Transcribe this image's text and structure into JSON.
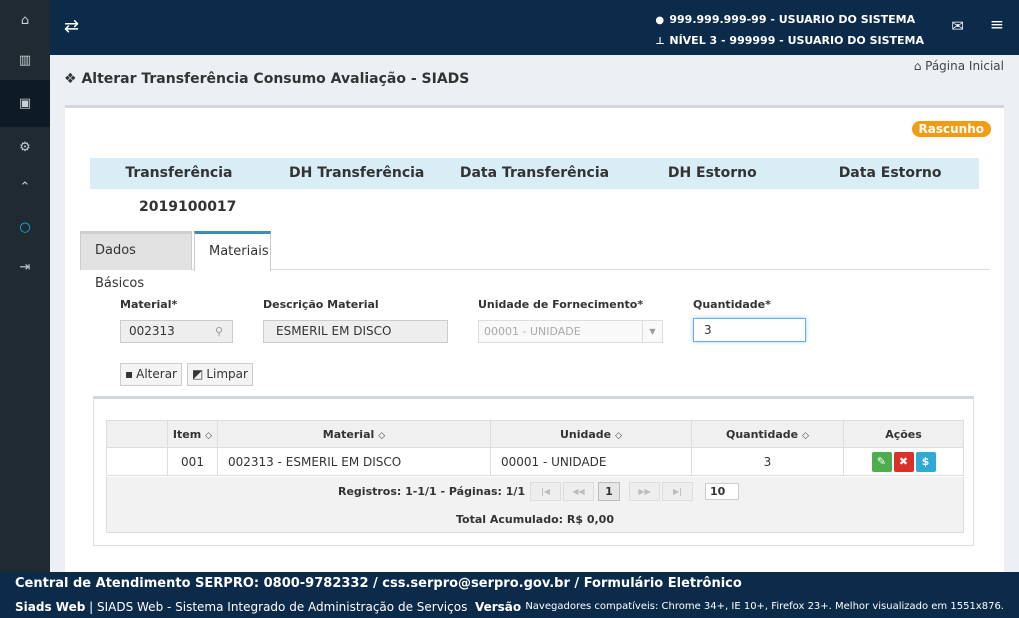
{
  "sidebar": {
    "items": [
      {
        "name": "home-icon",
        "glyph": "⌂"
      },
      {
        "name": "barcode-icon",
        "glyph": "▥"
      },
      {
        "name": "archive-icon",
        "glyph": "▣"
      },
      {
        "name": "cogs-icon",
        "glyph": "⚙"
      },
      {
        "name": "graduation-icon",
        "glyph": "⌃"
      },
      {
        "name": "circle-icon",
        "glyph": "○"
      },
      {
        "name": "sign-in-icon",
        "glyph": "⇥"
      }
    ]
  },
  "header": {
    "toggle_icon": "exchange-icon",
    "user_line": "999.999.999-99 - USUARIO DO SISTEMA",
    "level_line": "NÍVEL 3 - 999999 - USUARIO DO SISTEMA",
    "mail_icon": "envelope-icon",
    "menu_icon": "bars-icon"
  },
  "breadcrumb": {
    "label": "Página Inicial"
  },
  "page": {
    "title": "Alterar Transferência Consumo Avaliação - SIADS"
  },
  "status_badge": "Rascunho",
  "summary": {
    "headers": [
      "Transferência",
      "DH Transferência",
      "Data Transferência",
      "DH Estorno",
      "Data Estorno"
    ],
    "transferencia_value": "2019100017"
  },
  "tabs": [
    {
      "label": "Dados Básicos",
      "active": false
    },
    {
      "label": "Materiais",
      "active": true
    }
  ],
  "form": {
    "material_label": "Material*",
    "material_value": "002313",
    "descricao_label": "Descrição Material",
    "descricao_value": "ESMERIL EM DISCO",
    "unidade_label": "Unidade de Fornecimento*",
    "unidade_value": "00001 - UNIDADE",
    "quantidade_label": "Quantidade*",
    "quantidade_value": "3"
  },
  "buttons": {
    "alterar": "Alterar",
    "limpar": "Limpar"
  },
  "grid": {
    "headers": {
      "item": "Item",
      "material": "Material",
      "unidade": "Unidade",
      "quantidade": "Quantidade",
      "acoes": "Ações"
    },
    "rows": [
      {
        "item": "001",
        "material": "002313 - ESMERIL EM DISCO",
        "unidade": "00001 - UNIDADE",
        "quantidade": "3"
      }
    ],
    "pager_info": "Registros: 1-1/1 - Páginas: 1/1",
    "current_page": "1",
    "rows_per_page": "10",
    "total": "Total Acumulado: R$ 0,00"
  },
  "footer": {
    "central": "Central de Atendimento SERPRO: 0800-9782332 / css.serpro@serpro.gov.br / Formulário Eletrônico",
    "brand": "Siads Web",
    "system": "SIADS Web - Sistema Integrado de Administração de Serviços",
    "versao": "Versão",
    "browsers": "Navegadores compatíveis: Chrome 34+, IE 10+, Firefox 23+. Melhor visualizado em 1551x876."
  },
  "colors": {
    "header_bg": "#0c2b4b",
    "sidebar_bg": "#1f2a33",
    "badge": "#f39c12",
    "edit": "#4cae4c",
    "delete": "#d9302c",
    "money": "#2fa9d6"
  }
}
